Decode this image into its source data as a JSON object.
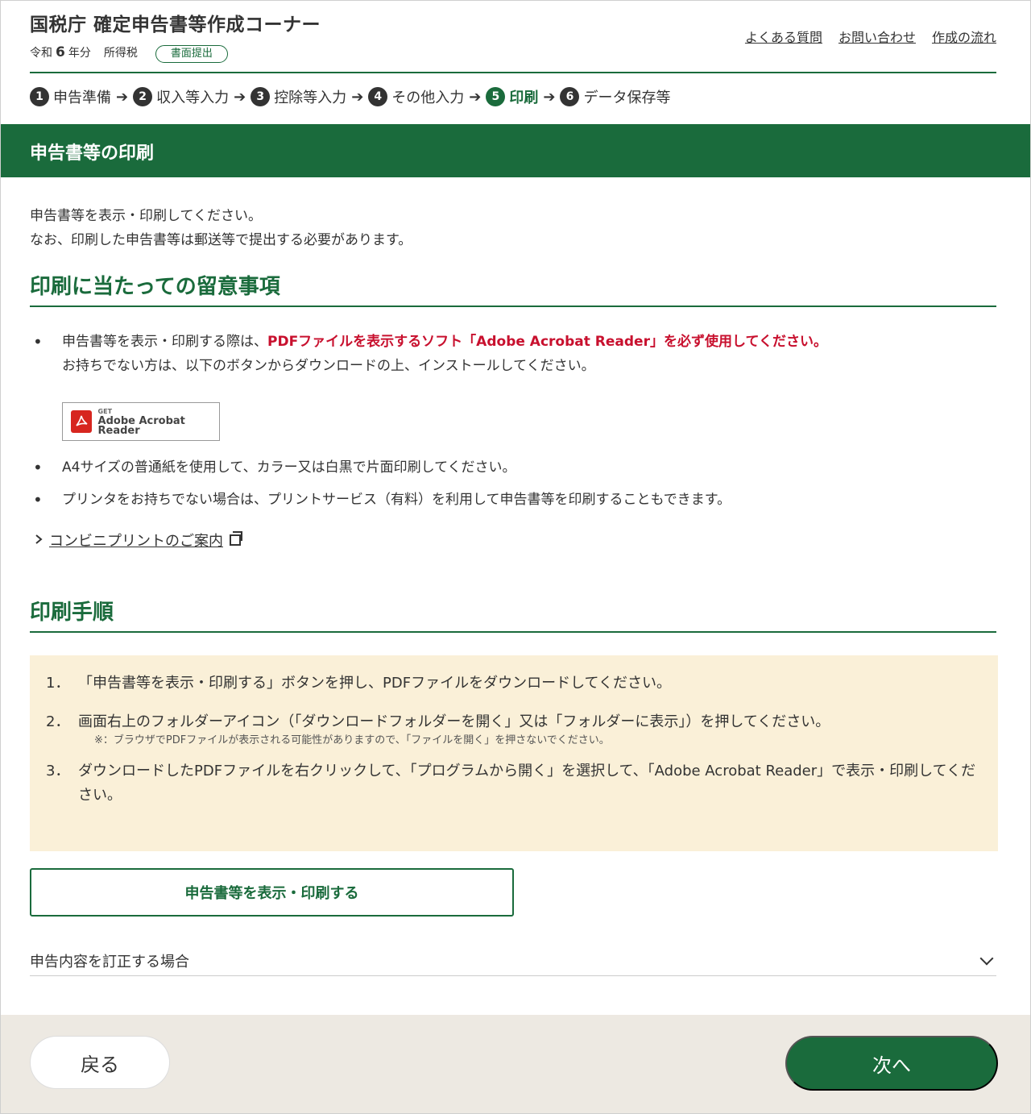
{
  "header": {
    "title": "国税庁 確定申告書等作成コーナー",
    "era": "令和",
    "year": "6",
    "year_suffix": "年分",
    "tax_type": "所得税",
    "badge": "書面提出",
    "links": [
      "よくある質問",
      "お問い合わせ",
      "作成の流れ"
    ]
  },
  "steps": [
    {
      "num": "1",
      "label": "申告準備"
    },
    {
      "num": "2",
      "label": "収入等入力"
    },
    {
      "num": "3",
      "label": "控除等入力"
    },
    {
      "num": "4",
      "label": "その他入力"
    },
    {
      "num": "5",
      "label": "印刷"
    },
    {
      "num": "6",
      "label": "データ保存等"
    }
  ],
  "step_arrow": "➔",
  "band": {
    "title": "申告書等の印刷"
  },
  "intro": {
    "line1": "申告書等を表示・印刷してください。",
    "line2": "なお、印刷した申告書等は郵送等で提出する必要があります。"
  },
  "section1": {
    "title": "印刷に当たっての留意事項",
    "bullet_mark": "•",
    "note1_prefix": "申告書等を表示・印刷する際は、",
    "note1_emphasis": "PDFファイルを表示するソフト「Adobe Acrobat Reader」を必ず使用してください。",
    "note1_line2": "お持ちでない方は、以下のボタンからダウンロードの上、インストールしてください。",
    "adobe_get": "GET",
    "adobe_name": "Adobe Acrobat Reader",
    "note2": "A4サイズの普通紙を使用して、カラー又は白黒で片面印刷してください。",
    "note3": "プリンタをお持ちでない場合は、プリントサービス（有料）を利用して申告書等を印刷することもできます。",
    "conv_link": "コンビニプリントのご案内"
  },
  "section2": {
    "title": "印刷手順",
    "steps": [
      {
        "idx": "1．",
        "text": "「申告書等を表示・印刷する」ボタンを押し、PDFファイルをダウンロードしてください。"
      },
      {
        "idx": "2．",
        "text": "画面右上のフォルダーアイコン（「ダウンロードフォルダーを開く」又は「フォルダーに表示」）を押してください。",
        "note": "※：ブラウザでPDFファイルが表示される可能性がありますので、「ファイルを開く」を押さないでください。"
      },
      {
        "idx": "3．",
        "text": "ダウンロードしたPDFファイルを右クリックして、「プログラムから開く」を選択して、「Adobe Acrobat Reader」で表示・印刷してください。"
      }
    ],
    "print_button": "申告書等を表示・印刷する",
    "accordion": "申告内容を訂正する場合"
  },
  "footer": {
    "back": "戻る",
    "next": "次へ"
  },
  "colors": {
    "brand_green": "#1a6b3c",
    "emphasis_red": "#c8102e",
    "procedure_bg": "#faf0d8",
    "footer_bg": "#ede9e2"
  }
}
